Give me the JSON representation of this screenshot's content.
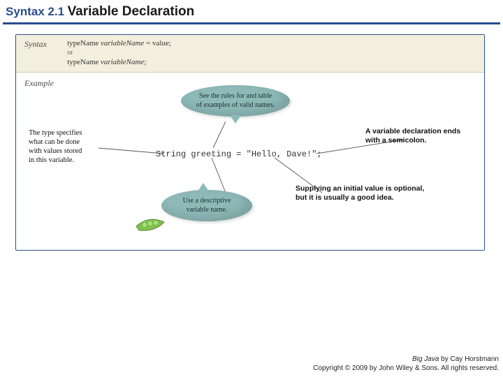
{
  "title": {
    "prefix": "Syntax 2.1",
    "main": "Variable Declaration"
  },
  "syntax": {
    "label": "Syntax",
    "line1_type": "typeName",
    "line1_var": "variableName",
    "line1_rest": " = value;",
    "or": "or",
    "line2_type": "typeName",
    "line2_var": "variableName",
    "line2_rest": ";"
  },
  "example": {
    "label": "Example",
    "code": "String greeting = \"Hello, Dave!\";"
  },
  "notes": {
    "typeSpecifies": "The type specifies\nwhat can be done\nwith values stored\nin this variable.",
    "validNames": "See the rules for and table\nof examples of valid names.",
    "endsSemicolon": "A variable declaration ends\nwith a semicolon.",
    "descriptiveName": "Use a descriptive\nvariable name.",
    "initialValue": "Supplying an initial value is optional,\nbut it is usually a good idea."
  },
  "footer": {
    "book": "Big Java",
    "by": " by Cay Horstmann",
    "copyright": "Copyright © 2009 by John Wiley & Sons. All rights reserved."
  }
}
